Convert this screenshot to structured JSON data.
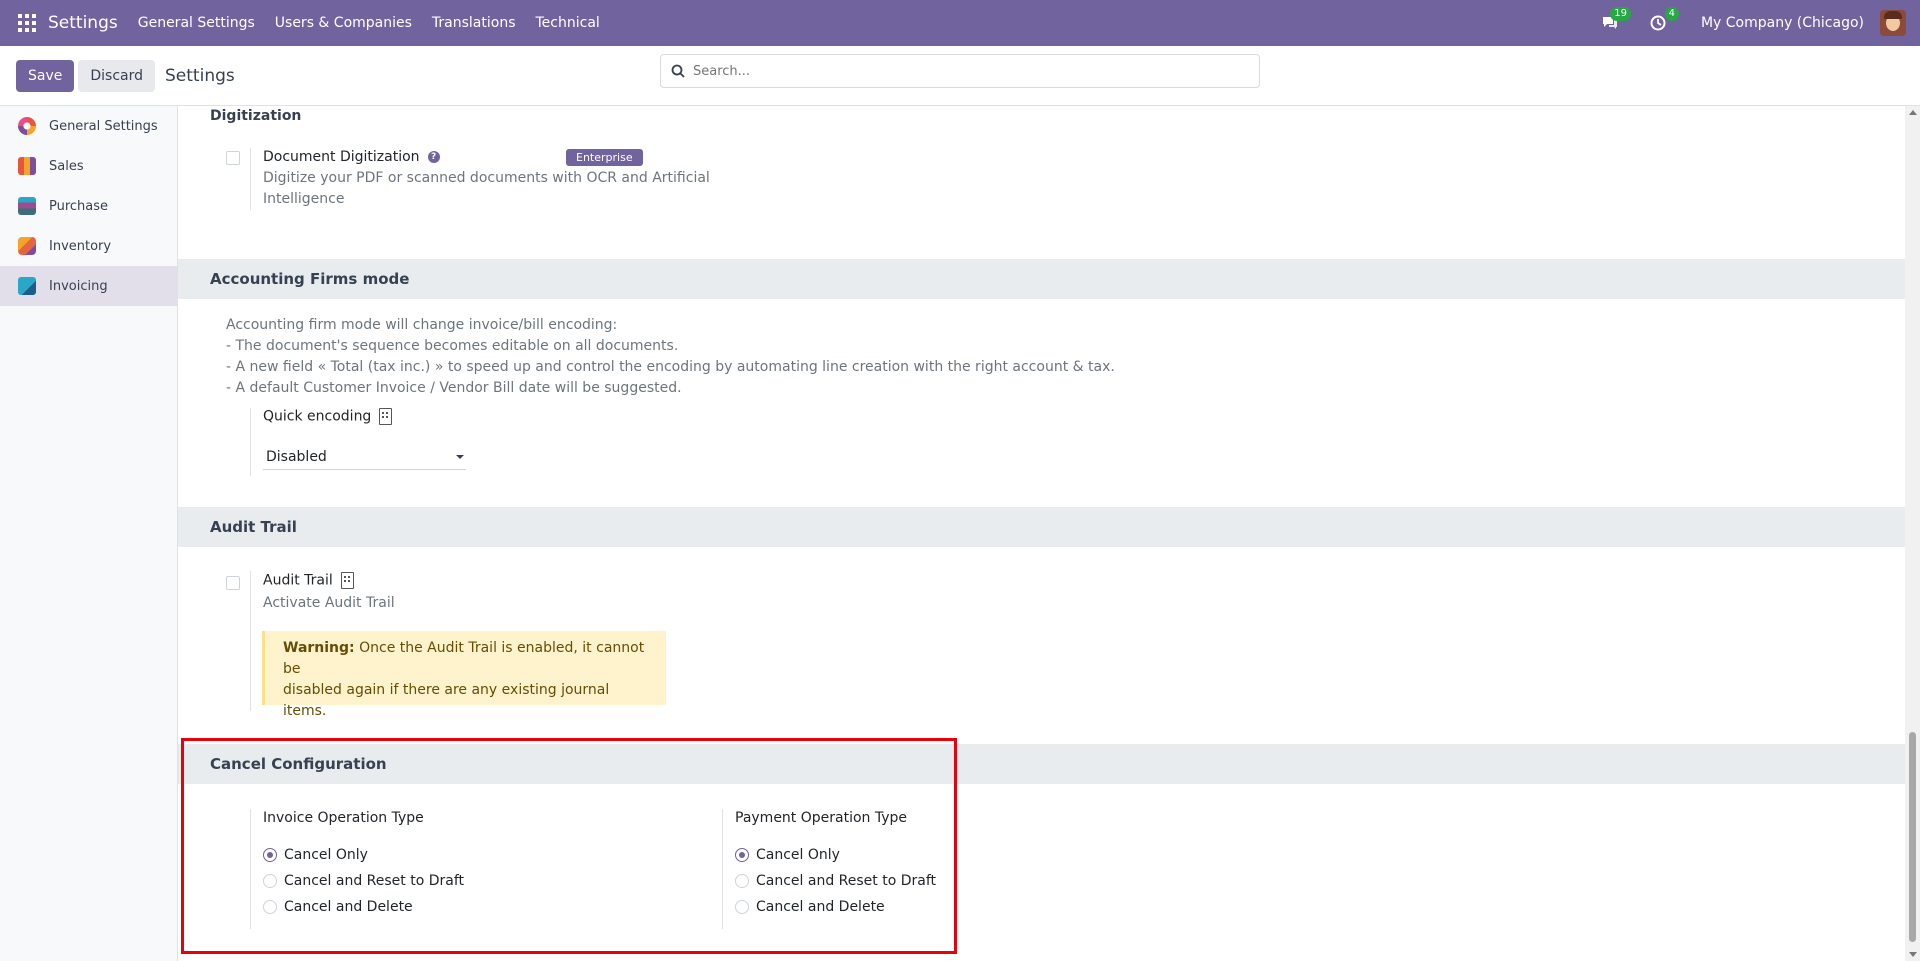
{
  "navbar": {
    "brand": "Settings",
    "menu": [
      "General Settings",
      "Users & Companies",
      "Translations",
      "Technical"
    ],
    "messages_count": "19",
    "activities_count": "4",
    "company": "My Company (Chicago)"
  },
  "control_panel": {
    "save_label": "Save",
    "discard_label": "Discard",
    "title": "Settings",
    "search_placeholder": "Search..."
  },
  "sidebar": {
    "items": [
      {
        "label": "General Settings",
        "color": "#e8553e"
      },
      {
        "label": "Sales",
        "color": "#f4a32b"
      },
      {
        "label": "Purchase",
        "color": "#3b6e7a"
      },
      {
        "label": "Inventory",
        "color": "#e6643f"
      },
      {
        "label": "Invoicing",
        "color": "#2aa6c8"
      }
    ]
  },
  "sections": {
    "digitization": {
      "header_partial": "Digitization",
      "title": "Document Digitization",
      "badge": "Enterprise",
      "description_line1": "Digitize your PDF or scanned documents with OCR and Artificial",
      "description_line2": "Intelligence"
    },
    "accounting_firms": {
      "header": "Accounting Firms mode",
      "desc_line1": "Accounting firm mode will change invoice/bill encoding:",
      "desc_line2": "- The document's sequence becomes editable on all documents.",
      "desc_line3": "- A new field « Total (tax inc.) » to speed up and control the encoding by automating line creation with the right account & tax.",
      "desc_line4": "- A default Customer Invoice / Vendor Bill date will be suggested.",
      "quick_encoding_label": "Quick encoding",
      "quick_encoding_value": "Disabled"
    },
    "audit_trail": {
      "header": "Audit Trail",
      "title": "Audit Trail",
      "description": "Activate Audit Trail",
      "warning_bold": "Warning:",
      "warning_line1": " Once the Audit Trail is enabled, it cannot be",
      "warning_line2": "disabled again if there are any existing journal items."
    },
    "cancel_configuration": {
      "header": "Cancel Configuration",
      "invoice_title": "Invoice Operation Type",
      "payment_title": "Payment Operation Type",
      "options": [
        "Cancel Only",
        "Cancel and Reset to Draft",
        "Cancel and Delete"
      ],
      "invoice_selected": "Cancel Only",
      "payment_selected": "Cancel Only"
    }
  },
  "highlight_color": "#e8000b"
}
